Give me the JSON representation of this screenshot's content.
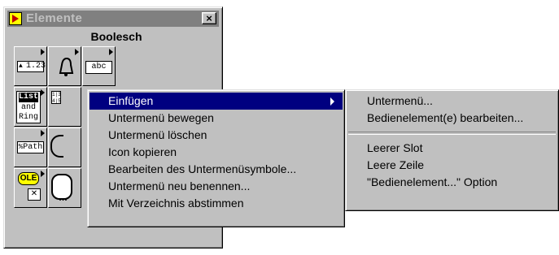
{
  "window": {
    "title": "Elemente",
    "close_label": "×",
    "subheading": "Boolesch"
  },
  "palette_icons": [
    {
      "name": "numeric-icon",
      "text": "1.23"
    },
    {
      "name": "bell-icon",
      "text": ""
    },
    {
      "name": "string-icon",
      "text": "abc"
    },
    {
      "name": "list-and-ring-icon",
      "text_top": "List",
      "text_mid": "and",
      "text_bot": "Ring"
    },
    {
      "name": "array-cluster-icon",
      "text": ""
    },
    {
      "name": "path-icon",
      "text": "Path"
    },
    {
      "name": "ole-icon",
      "text": "OLE"
    }
  ],
  "context_menu": {
    "items": [
      {
        "label": "Einfügen",
        "active": true,
        "has_submenu": true
      },
      {
        "label": "Untermenü bewegen"
      },
      {
        "label": "Untermenü löschen"
      },
      {
        "label": "Icon kopieren"
      },
      {
        "label": "Bearbeiten des Untermenüsymbole..."
      },
      {
        "label": "Untermenü neu benennen..."
      },
      {
        "label": "Mit Verzeichnis abstimmen"
      }
    ]
  },
  "submenu": {
    "group1": [
      {
        "label": "Untermenü..."
      },
      {
        "label": "Bedienelement(e) bearbeiten..."
      }
    ],
    "group2": [
      {
        "label": "Leerer Slot"
      },
      {
        "label": "Leere Zeile"
      },
      {
        "label": "\"Bedienelement...\" Option"
      }
    ]
  },
  "colors": {
    "face": "#c0c0c0",
    "highlight": "#000080",
    "title_inactive": "#808080"
  }
}
